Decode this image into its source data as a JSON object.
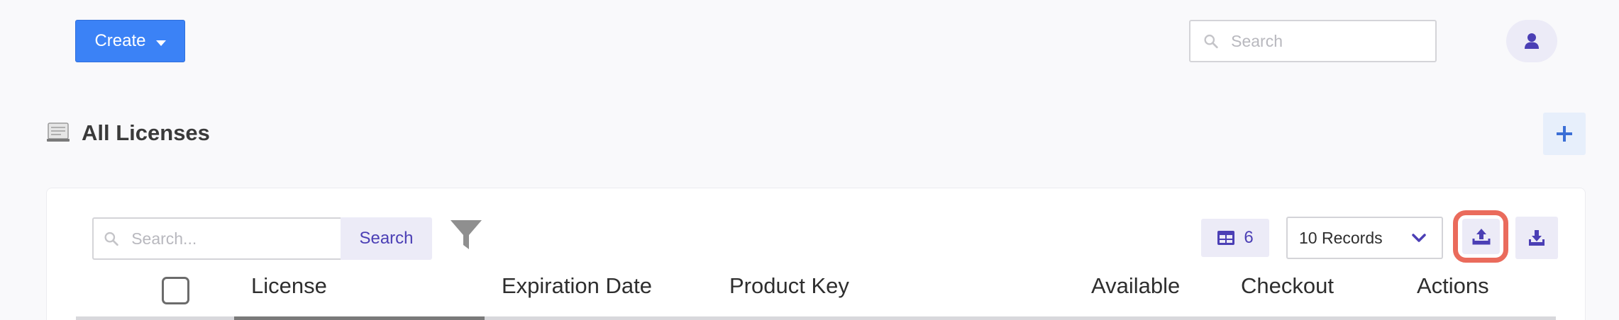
{
  "topbar": {
    "create_label": "Create",
    "search_placeholder": "Search"
  },
  "page": {
    "title": "All Licenses"
  },
  "toolbar": {
    "search_placeholder": "Search...",
    "search_button": "Search",
    "columns_count": "6",
    "records_select": "10 Records"
  },
  "table": {
    "headers": [
      "License",
      "Expiration Date",
      "Product Key",
      "Available",
      "Checkout",
      "Actions"
    ]
  },
  "colors": {
    "primary": "#3b82f6",
    "accent": "#4b3fb5",
    "accent_bg": "#ecebf7",
    "highlight_ring": "#ea6b5c"
  },
  "icons": {
    "create_caret": "chevron-down-icon",
    "top_search": "search-icon",
    "avatar": "user-icon",
    "title": "license-icon",
    "add": "plus-icon",
    "table_search": "search-icon",
    "filter": "filter-icon",
    "columns": "table-icon",
    "records": "chevron-down-icon",
    "upload": "upload-icon",
    "download": "download-icon"
  }
}
